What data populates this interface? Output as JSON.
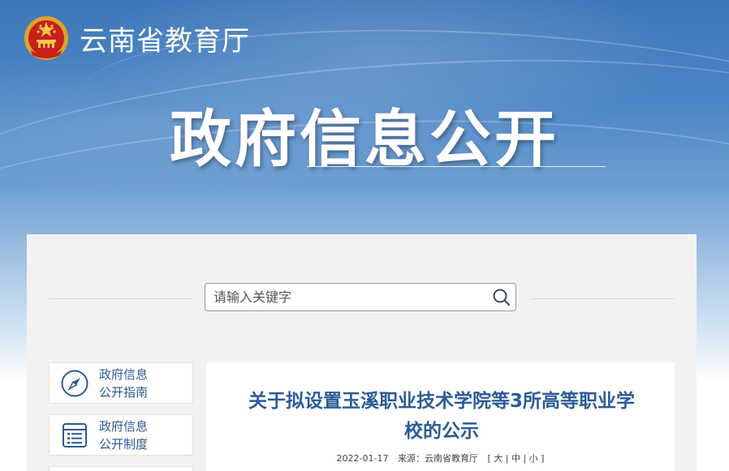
{
  "header": {
    "org_name": "云南省教育厅",
    "banner_title": "政府信息公开"
  },
  "search": {
    "placeholder": "请输入关键字"
  },
  "sidebar": {
    "items": [
      {
        "label": "政府信息\n公开指南",
        "icon": "compass-icon"
      },
      {
        "label": "政府信息\n公开制度",
        "icon": "document-list-icon"
      }
    ]
  },
  "article": {
    "title": "关于拟设置玉溪职业技术学院等3所高等职业学校的公示",
    "date": "2022-01-17",
    "source_label": "来源：",
    "source": "云南省教育厅",
    "font_sizes": [
      "大",
      "中",
      "小"
    ]
  },
  "colors": {
    "brand_blue": "#2b5c97",
    "banner_blue": "#3f77b9",
    "panel_bg": "#f2f2f2"
  }
}
